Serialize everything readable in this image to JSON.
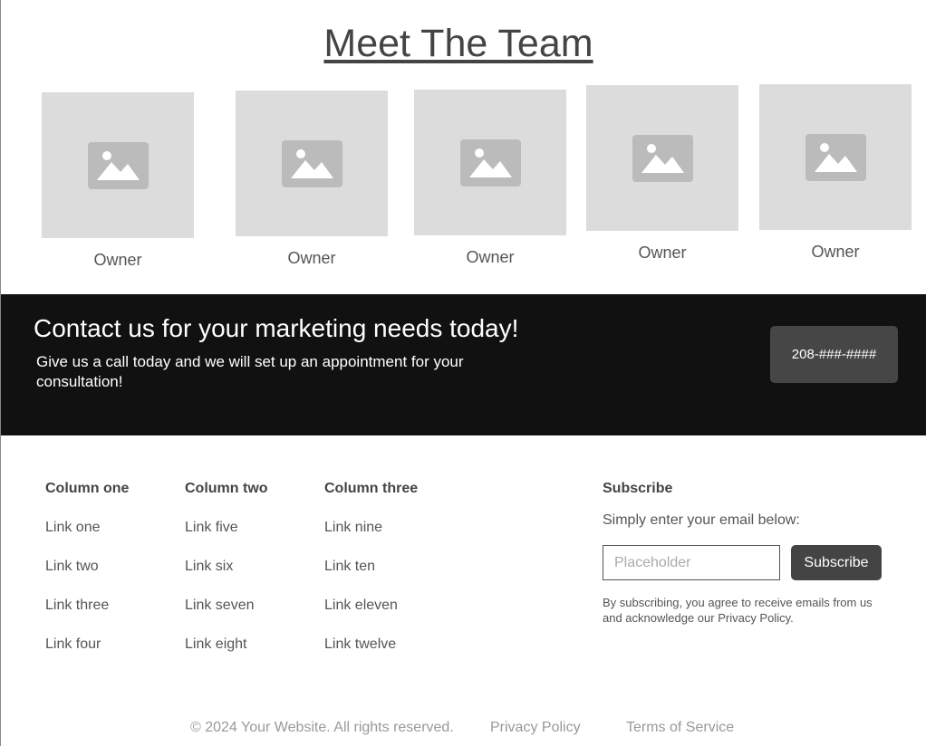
{
  "team": {
    "title": "Meet The Team",
    "members": [
      {
        "role": "Owner"
      },
      {
        "role": "Owner"
      },
      {
        "role": "Owner"
      },
      {
        "role": "Owner"
      },
      {
        "role": "Owner"
      }
    ]
  },
  "cta": {
    "heading": "Contact us for your marketing needs today!",
    "subtext": "Give us a call today and we will set up an appointment for your consultation!",
    "phone_button": "208-###-####"
  },
  "footer": {
    "columns": [
      {
        "title": "Column one",
        "links": [
          "Link one",
          "Link two",
          "Link three",
          "Link four"
        ]
      },
      {
        "title": "Column two",
        "links": [
          "Link five",
          "Link six",
          "Link seven",
          "Link eight"
        ]
      },
      {
        "title": "Column three",
        "links": [
          "Link nine",
          "Link ten",
          "Link eleven",
          "Link twelve"
        ]
      }
    ],
    "subscribe": {
      "title": "Subscribe",
      "description": "Simply enter your email below:",
      "input_placeholder": "Placeholder",
      "button_label": "Subscribe",
      "note": "By subscribing, you agree to receive emails from us and acknowledge our Privacy Policy."
    },
    "copyright": "© 2024 Your Website. All rights reserved.",
    "privacy_link": "Privacy Policy",
    "terms_link": "Terms of Service"
  },
  "colors": {
    "cta_background": "#111111",
    "button_background": "#444444",
    "photo_placeholder": "#dcdcdc"
  },
  "icons": {
    "photo": "image-placeholder-icon"
  }
}
